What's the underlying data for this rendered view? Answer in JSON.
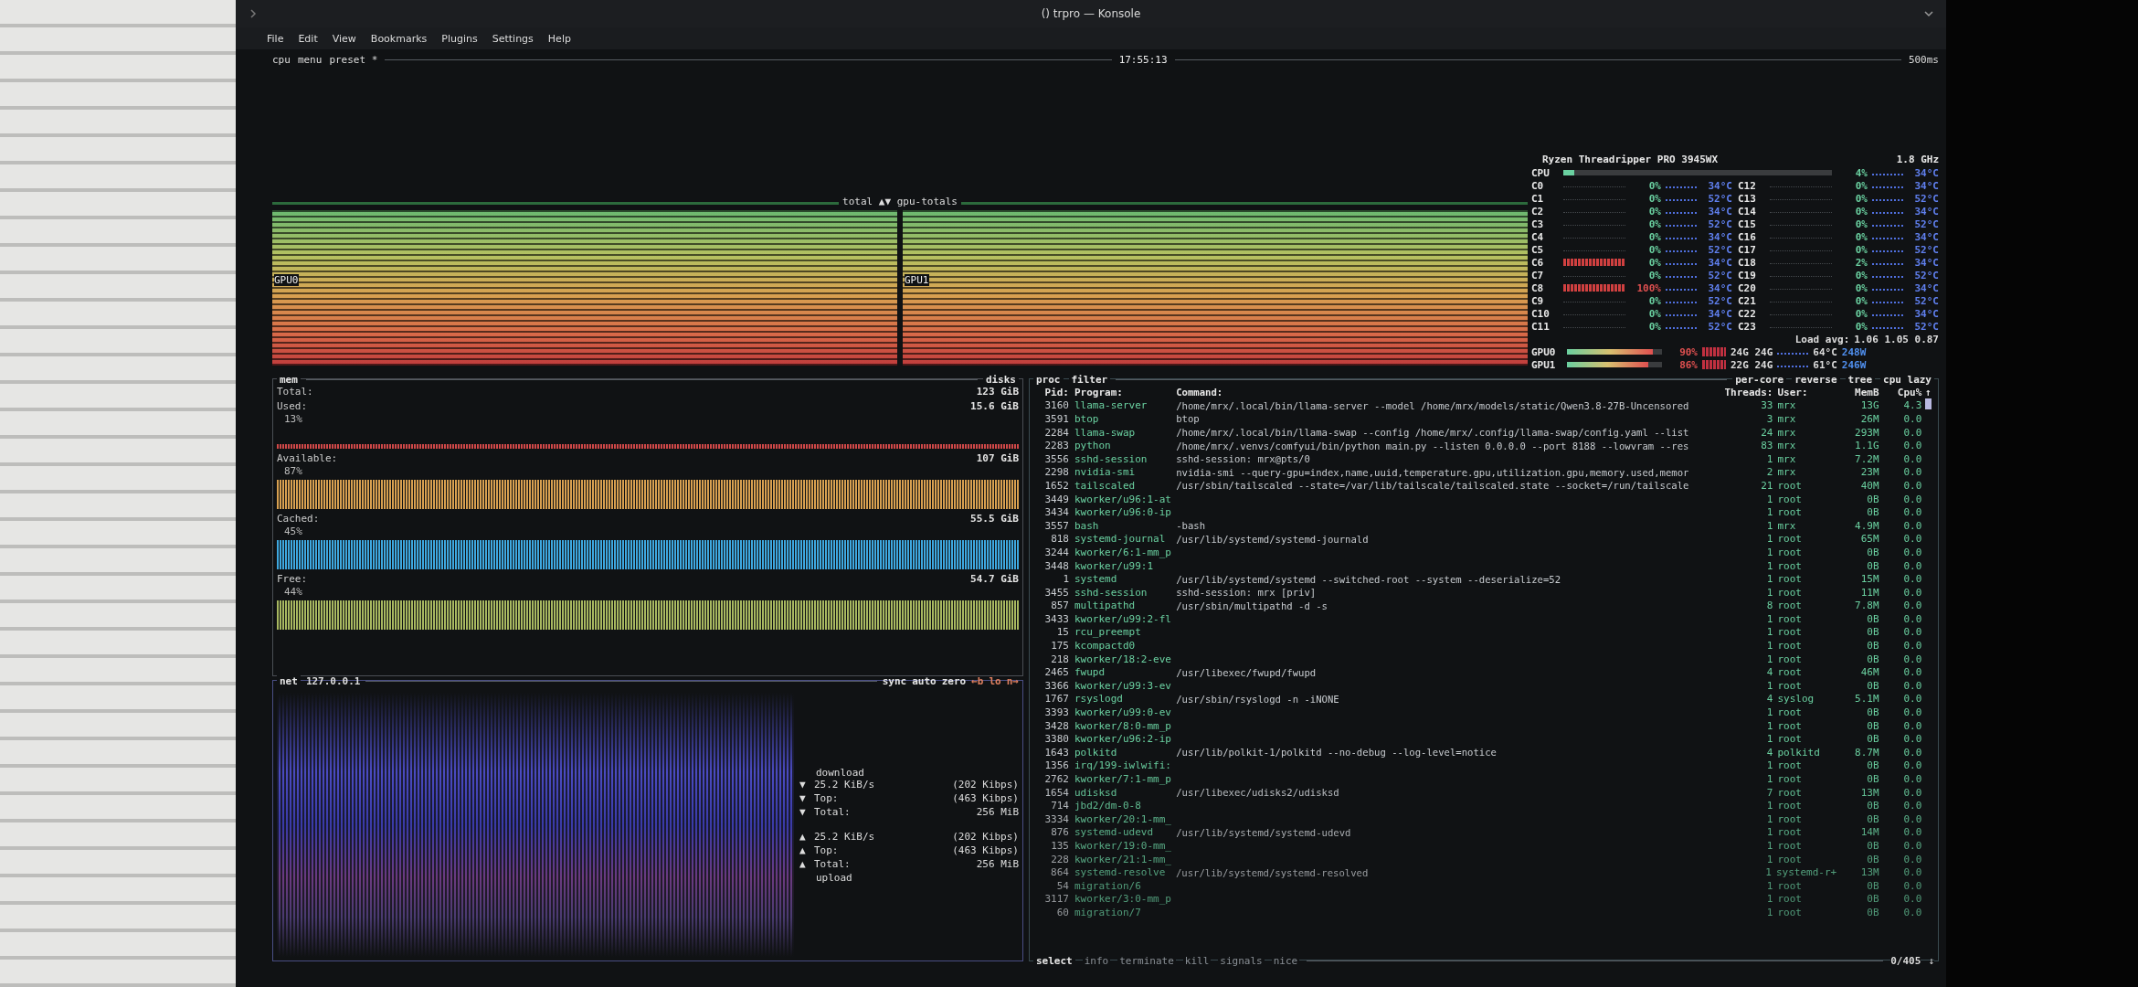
{
  "window": {
    "title": "() trpro — Konsole"
  },
  "menu": [
    "File",
    "Edit",
    "View",
    "Bookmarks",
    "Plugins",
    "Settings",
    "Help"
  ],
  "topbar": {
    "tabs": [
      "cpu",
      "menu",
      "preset *"
    ],
    "clock": "17:55:13",
    "interval": "500ms"
  },
  "graph": {
    "title": "total ▲▼ gpu-totals",
    "panels": [
      "GPU0",
      "GPU1"
    ]
  },
  "cpu": {
    "name": "Ryzen Threadripper PRO 3945WX",
    "freq": "1.8 GHz",
    "label": "CPU",
    "level": 0.04,
    "pct": "4%",
    "temp": "34°C",
    "cores": [
      {
        "name": "C0",
        "pct": "0%",
        "temp": "34°C",
        "busy": false,
        "alert": false
      },
      {
        "name": "C1",
        "pct": "0%",
        "temp": "52°C",
        "busy": false,
        "alert": false
      },
      {
        "name": "C2",
        "pct": "0%",
        "temp": "34°C",
        "busy": false,
        "alert": false
      },
      {
        "name": "C3",
        "pct": "0%",
        "temp": "52°C",
        "busy": false,
        "alert": false
      },
      {
        "name": "C4",
        "pct": "0%",
        "temp": "34°C",
        "busy": false,
        "alert": false
      },
      {
        "name": "C5",
        "pct": "0%",
        "temp": "52°C",
        "busy": false,
        "alert": false
      },
      {
        "name": "C6",
        "pct": "0%",
        "temp": "34°C",
        "busy": true,
        "alert": false
      },
      {
        "name": "C7",
        "pct": "0%",
        "temp": "52°C",
        "busy": false,
        "alert": false
      },
      {
        "name": "C8",
        "pct": "100%",
        "temp": "34°C",
        "busy": true,
        "alert": true
      },
      {
        "name": "C9",
        "pct": "0%",
        "temp": "52°C",
        "busy": false,
        "alert": false
      },
      {
        "name": "C10",
        "pct": "0%",
        "temp": "34°C",
        "busy": false,
        "alert": false
      },
      {
        "name": "C11",
        "pct": "0%",
        "temp": "52°C",
        "busy": false,
        "alert": false
      },
      {
        "name": "C12",
        "pct": "0%",
        "temp": "34°C",
        "busy": false,
        "alert": false
      },
      {
        "name": "C13",
        "pct": "0%",
        "temp": "52°C",
        "busy": false,
        "alert": false
      },
      {
        "name": "C14",
        "pct": "0%",
        "temp": "34°C",
        "busy": false,
        "alert": false
      },
      {
        "name": "C15",
        "pct": "0%",
        "temp": "52°C",
        "busy": false,
        "alert": false
      },
      {
        "name": "C16",
        "pct": "0%",
        "temp": "34°C",
        "busy": false,
        "alert": false
      },
      {
        "name": "C17",
        "pct": "0%",
        "temp": "52°C",
        "busy": false,
        "alert": false
      },
      {
        "name": "C18",
        "pct": "2%",
        "temp": "34°C",
        "busy": false,
        "alert": false
      },
      {
        "name": "C19",
        "pct": "0%",
        "temp": "52°C",
        "busy": false,
        "alert": false
      },
      {
        "name": "C20",
        "pct": "0%",
        "temp": "34°C",
        "busy": false,
        "alert": false
      },
      {
        "name": "C21",
        "pct": "0%",
        "temp": "52°C",
        "busy": false,
        "alert": false
      },
      {
        "name": "C22",
        "pct": "0%",
        "temp": "34°C",
        "busy": false,
        "alert": false
      },
      {
        "name": "C23",
        "pct": "0%",
        "temp": "52°C",
        "busy": false,
        "alert": false
      }
    ],
    "load_label": "Load avg:",
    "load": "1.06 1.05 0.87",
    "gpus": [
      {
        "name": "GPU0",
        "level": 0.9,
        "pct": "90%",
        "mem": "24G 24G",
        "temp": "64°C",
        "power": "248W"
      },
      {
        "name": "GPU1",
        "level": 0.86,
        "pct": "86%",
        "mem": "22G 24G",
        "temp": "61°C",
        "power": "246W"
      }
    ]
  },
  "mem": {
    "title": "mem",
    "disks": "disks",
    "total_label": "Total:",
    "total": "123 GiB",
    "items": [
      {
        "label": "Used:",
        "value": "15.6 GiB",
        "pct": "13%",
        "color": "#d04848"
      },
      {
        "label": "Available:",
        "value": "107 GiB",
        "pct": "87%",
        "color": "#d8a050"
      },
      {
        "label": "Cached:",
        "value": "55.5 GiB",
        "pct": "45%",
        "color": "#3ea8e0"
      },
      {
        "label": "Free:",
        "value": "54.7 GiB",
        "pct": "44%",
        "color": "#a8b860"
      }
    ]
  },
  "net": {
    "title": "net",
    "iface": "127.0.0.1",
    "buttons": [
      "sync",
      "auto",
      "zero",
      "←b",
      "lo",
      "n→"
    ],
    "download_label": "download",
    "upload_label": "upload",
    "download": [
      {
        "icon": "▼",
        "label": "25.2 KiB/s",
        "value": "(202 Kibps)"
      },
      {
        "icon": "▼",
        "label": "Top:",
        "value": "(463 Kibps)"
      },
      {
        "icon": "▼",
        "label": "Total:",
        "value": "256 MiB"
      }
    ],
    "upload": [
      {
        "icon": "▲",
        "label": "25.2 KiB/s",
        "value": "(202 Kibps)"
      },
      {
        "icon": "▲",
        "label": "Top:",
        "value": "(463 Kibps)"
      },
      {
        "icon": "▲",
        "label": "Total:",
        "value": "256 MiB"
      }
    ]
  },
  "proc": {
    "title": "proc",
    "filter": "filter",
    "options": [
      "per-core",
      "reverse",
      "tree",
      "cpu lazy"
    ],
    "columns": [
      "Pid:",
      "Program:",
      "Command:",
      "Threads:",
      "User:",
      "MemB",
      "Cpu%"
    ],
    "scroll_up": "↑",
    "scroll_down": "↓",
    "count": "0/405",
    "select": "select",
    "keys": [
      "info",
      "terminate",
      "kill",
      "signals",
      "nice"
    ],
    "rows": [
      {
        "pid": "3160",
        "program": "llama-server",
        "command": "/home/mrx/.local/bin/llama-server --model /home/mrx/models/static/Qwen3.8-27B-Uncensored",
        "threads": "33",
        "user": "mrx",
        "mem": "13G",
        "cpu": "4.3"
      },
      {
        "pid": "3591",
        "program": "btop",
        "command": "btop",
        "threads": "3",
        "user": "mrx",
        "mem": "26M",
        "cpu": "0.0"
      },
      {
        "pid": "2284",
        "program": "llama-swap",
        "command": "/home/mrx/.local/bin/llama-swap --config /home/mrx/.config/llama-swap/config.yaml --list",
        "threads": "24",
        "user": "mrx",
        "mem": "293M",
        "cpu": "0.0"
      },
      {
        "pid": "2283",
        "program": "python",
        "command": "/home/mrx/.venvs/comfyui/bin/python main.py --listen 0.0.0.0 --port 8188 --lowvram --res",
        "threads": "83",
        "user": "mrx",
        "mem": "1.1G",
        "cpu": "0.0"
      },
      {
        "pid": "3556",
        "program": "sshd-session",
        "command": "sshd-session: mrx@pts/0",
        "threads": "1",
        "user": "mrx",
        "mem": "7.2M",
        "cpu": "0.0"
      },
      {
        "pid": "2298",
        "program": "nvidia-smi",
        "command": "nvidia-smi --query-gpu=index,name,uuid,temperature.gpu,utilization.gpu,memory.used,memor",
        "threads": "2",
        "user": "mrx",
        "mem": "23M",
        "cpu": "0.0"
      },
      {
        "pid": "1652",
        "program": "tailscaled",
        "command": "/usr/sbin/tailscaled --state=/var/lib/tailscale/tailscaled.state --socket=/run/tailscale",
        "threads": "21",
        "user": "root",
        "mem": "40M",
        "cpu": "0.0"
      },
      {
        "pid": "3449",
        "program": "kworker/u96:1-at",
        "threads": "1",
        "user": "root",
        "mem": "0B",
        "cpu": "0.0"
      },
      {
        "pid": "3434",
        "program": "kworker/u96:0-ip",
        "threads": "1",
        "user": "root",
        "mem": "0B",
        "cpu": "0.0"
      },
      {
        "pid": "3557",
        "program": "bash",
        "command": "-bash",
        "threads": "1",
        "user": "mrx",
        "mem": "4.9M",
        "cpu": "0.0"
      },
      {
        "pid": "818",
        "program": "systemd-journal",
        "command": "/usr/lib/systemd/systemd-journald",
        "threads": "1",
        "user": "root",
        "mem": "65M",
        "cpu": "0.0"
      },
      {
        "pid": "3244",
        "program": "kworker/6:1-mm_p",
        "threads": "1",
        "user": "root",
        "mem": "0B",
        "cpu": "0.0"
      },
      {
        "pid": "3448",
        "program": "kworker/u99:1",
        "threads": "1",
        "user": "root",
        "mem": "0B",
        "cpu": "0.0"
      },
      {
        "pid": "1",
        "program": "systemd",
        "command": "/usr/lib/systemd/systemd --switched-root --system --deserialize=52",
        "threads": "1",
        "user": "root",
        "mem": "15M",
        "cpu": "0.0"
      },
      {
        "pid": "3455",
        "program": "sshd-session",
        "command": "sshd-session: mrx [priv]",
        "threads": "1",
        "user": "root",
        "mem": "11M",
        "cpu": "0.0"
      },
      {
        "pid": "857",
        "program": "multipathd",
        "command": "/usr/sbin/multipathd -d -s",
        "threads": "8",
        "user": "root",
        "mem": "7.8M",
        "cpu": "0.0"
      },
      {
        "pid": "3433",
        "program": "kworker/u99:2-fl",
        "threads": "1",
        "user": "root",
        "mem": "0B",
        "cpu": "0.0"
      },
      {
        "pid": "15",
        "program": "rcu_preempt",
        "threads": "1",
        "user": "root",
        "mem": "0B",
        "cpu": "0.0"
      },
      {
        "pid": "175",
        "program": "kcompactd0",
        "threads": "1",
        "user": "root",
        "mem": "0B",
        "cpu": "0.0"
      },
      {
        "pid": "218",
        "program": "kworker/18:2-eve",
        "threads": "1",
        "user": "root",
        "mem": "0B",
        "cpu": "0.0"
      },
      {
        "pid": "2465",
        "program": "fwupd",
        "command": "/usr/libexec/fwupd/fwupd",
        "threads": "4",
        "user": "root",
        "mem": "46M",
        "cpu": "0.0"
      },
      {
        "pid": "3366",
        "program": "kworker/u99:3-ev",
        "threads": "1",
        "user": "root",
        "mem": "0B",
        "cpu": "0.0"
      },
      {
        "pid": "1767",
        "program": "rsyslogd",
        "command": "/usr/sbin/rsyslogd -n -iNONE",
        "threads": "4",
        "user": "syslog",
        "mem": "5.1M",
        "cpu": "0.0"
      },
      {
        "pid": "3393",
        "program": "kworker/u99:0-ev",
        "threads": "1",
        "user": "root",
        "mem": "0B",
        "cpu": "0.0"
      },
      {
        "pid": "3428",
        "program": "kworker/8:0-mm_p",
        "threads": "1",
        "user": "root",
        "mem": "0B",
        "cpu": "0.0"
      },
      {
        "pid": "3380",
        "program": "kworker/u96:2-ip",
        "threads": "1",
        "user": "root",
        "mem": "0B",
        "cpu": "0.0"
      },
      {
        "pid": "1643",
        "program": "polkitd",
        "command": "/usr/lib/polkit-1/polkitd --no-debug --log-level=notice",
        "threads": "4",
        "user": "polkitd",
        "mem": "8.7M",
        "cpu": "0.0"
      },
      {
        "pid": "1356",
        "program": "irq/199-iwlwifi:",
        "threads": "1",
        "user": "root",
        "mem": "0B",
        "cpu": "0.0"
      },
      {
        "pid": "2762",
        "program": "kworker/7:1-mm_p",
        "threads": "1",
        "user": "root",
        "mem": "0B",
        "cpu": "0.0"
      },
      {
        "pid": "1654",
        "program": "udisksd",
        "command": "/usr/libexec/udisks2/udisksd",
        "threads": "7",
        "user": "root",
        "mem": "13M",
        "cpu": "0.0"
      },
      {
        "pid": "714",
        "program": "jbd2/dm-0-8",
        "threads": "1",
        "user": "root",
        "mem": "0B",
        "cpu": "0.0"
      },
      {
        "pid": "3334",
        "program": "kworker/20:1-mm_",
        "threads": "1",
        "user": "root",
        "mem": "0B",
        "cpu": "0.0"
      },
      {
        "pid": "876",
        "program": "systemd-udevd",
        "command": "/usr/lib/systemd/systemd-udevd",
        "threads": "1",
        "user": "root",
        "mem": "14M",
        "cpu": "0.0"
      },
      {
        "pid": "135",
        "program": "kworker/19:0-mm_",
        "threads": "1",
        "user": "root",
        "mem": "0B",
        "cpu": "0.0"
      },
      {
        "pid": "228",
        "program": "kworker/21:1-mm_",
        "threads": "1",
        "user": "root",
        "mem": "0B",
        "cpu": "0.0"
      },
      {
        "pid": "864",
        "program": "systemd-resolve",
        "command": "/usr/lib/systemd/systemd-resolved",
        "threads": "1",
        "user": "systemd-r+",
        "mem": "13M",
        "cpu": "0.0"
      },
      {
        "pid": "54",
        "program": "migration/6",
        "threads": "1",
        "user": "root",
        "mem": "0B",
        "cpu": "0.0"
      },
      {
        "pid": "3117",
        "program": "kworker/3:0-mm_p",
        "threads": "1",
        "user": "root",
        "mem": "0B",
        "cpu": "0.0"
      },
      {
        "pid": "60",
        "program": "migration/7",
        "threads": "1",
        "user": "root",
        "mem": "0B",
        "cpu": "0.0"
      }
    ]
  }
}
